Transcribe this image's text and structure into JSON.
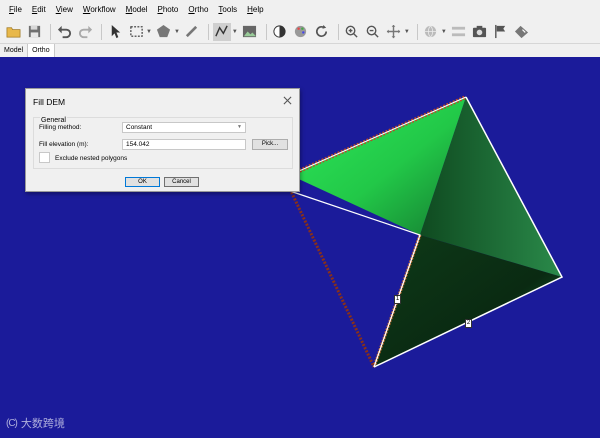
{
  "menu": [
    {
      "u": "F",
      "rest": "ile"
    },
    {
      "u": "E",
      "rest": "dit"
    },
    {
      "u": "V",
      "rest": "iew"
    },
    {
      "u": "W",
      "rest": "orkflow"
    },
    {
      "u": "M",
      "rest": "odel"
    },
    {
      "u": "P",
      "rest": "hoto"
    },
    {
      "u": "O",
      "rest": "rtho"
    },
    {
      "u": "T",
      "rest": "ools"
    },
    {
      "u": "H",
      "rest": "elp"
    }
  ],
  "view_tabs": [
    {
      "label": "Model",
      "active": false
    },
    {
      "label": "Ortho",
      "active": true
    }
  ],
  "dialog": {
    "title": "Fill DEM",
    "group_label": "General",
    "filling_method_label": "Filling method:",
    "filling_method_value": "Constant",
    "fill_elevation_label": "Fill elevation (m):",
    "fill_elevation_value": "154.042",
    "pick_label": "Pick...",
    "exclude_label": "Exclude nested polygons",
    "exclude_checked": false,
    "ok_label": "OK",
    "cancel_label": "Cancel"
  },
  "canvas": {
    "background": "#1b1b9a",
    "markers": [
      "1",
      "2"
    ]
  },
  "watermark": {
    "text": "大数跨境"
  }
}
